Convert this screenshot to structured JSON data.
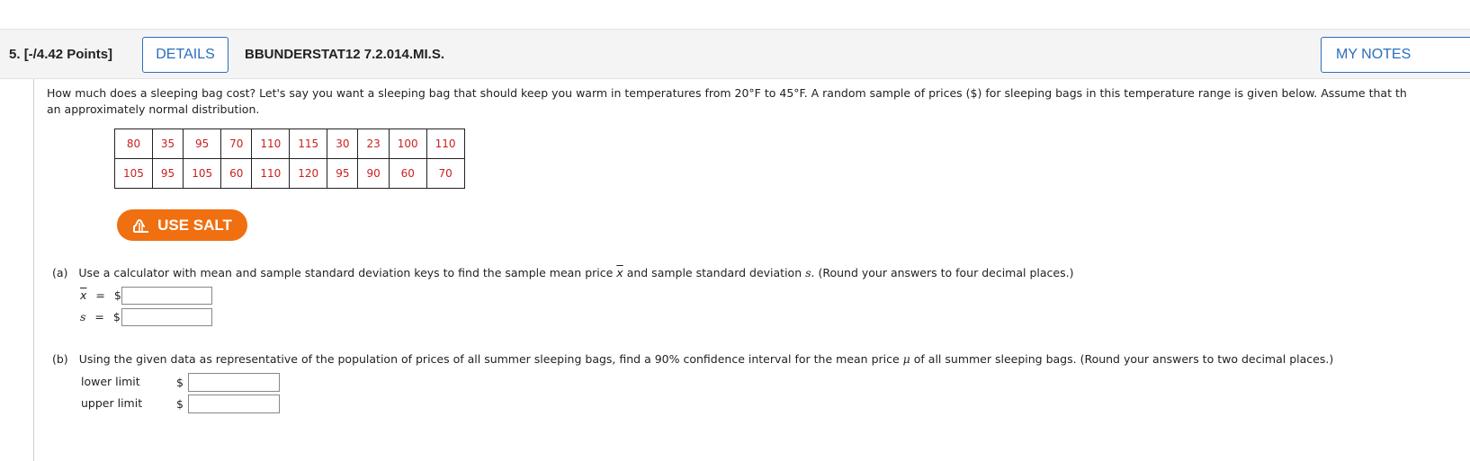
{
  "header": {
    "question_number": "5.",
    "points": "[-/4.42 Points]",
    "details_label": "DETAILS",
    "question_code": "BBUNDERSTAT12 7.2.014.MI.S.",
    "notes_label": "MY NOTES"
  },
  "prompt": {
    "line1": "How much does a sleeping bag cost? Let's say you want a sleeping bag that should keep you warm in temperatures from 20°F to 45°F. A random sample of prices ($) for sleeping bags in this temperature range is given below. Assume that th",
    "line2": "an approximately normal distribution."
  },
  "data_table": {
    "row1": [
      "80",
      "35",
      "95",
      "70",
      "110",
      "115",
      "30",
      "23",
      "100",
      "110"
    ],
    "row2": [
      "105",
      "95",
      "105",
      "60",
      "110",
      "120",
      "95",
      "90",
      "60",
      "70"
    ]
  },
  "salt_button": {
    "label": "USE SALT",
    "icon": "salt-icon",
    "color": "#f06f10"
  },
  "part_a": {
    "marker": "(a)",
    "text_before": "Use a calculator with mean and sample standard deviation keys to find the sample mean price",
    "xbar_symbol": "x",
    "text_middle": "and sample standard deviation",
    "s_symbol": "s",
    "text_after": ". (Round your answers to four decimal places.)",
    "xbar_label": "x",
    "s_label": "s",
    "equals": "=",
    "currency": "$",
    "xbar_value": "",
    "s_value": ""
  },
  "part_b": {
    "marker": "(b)",
    "text_before": "Using the given data as representative of the population of prices of all summer sleeping bags, find a 90% confidence interval for the mean price",
    "mu_symbol": "μ",
    "text_after": "of all summer sleeping bags. (Round your answers to two decimal places.)",
    "lower_label": "lower limit",
    "upper_label": "upper limit",
    "currency": "$",
    "lower_value": "",
    "upper_value": ""
  },
  "colors": {
    "accent": "#2a6ebb",
    "data_text": "#cc1f1f",
    "salt": "#f06f10"
  }
}
